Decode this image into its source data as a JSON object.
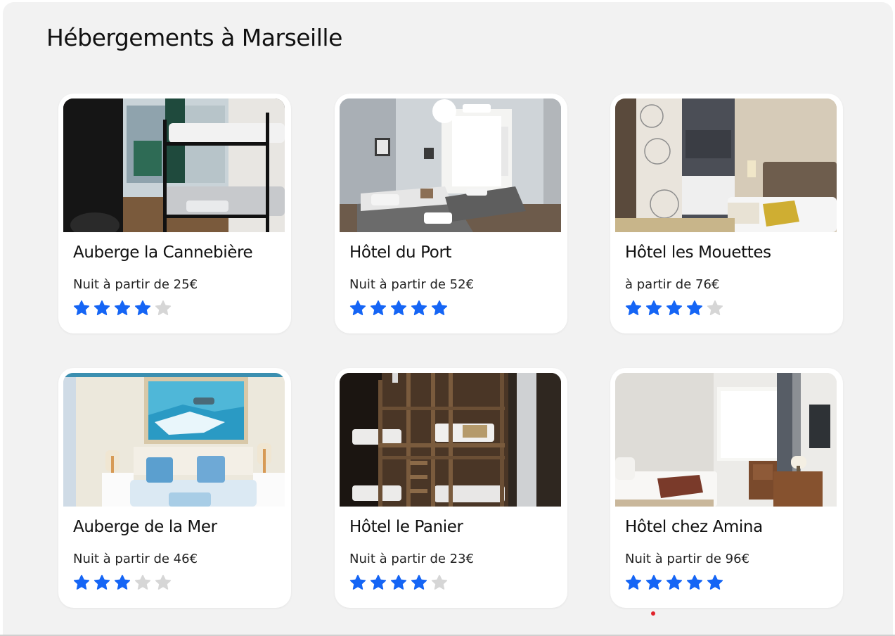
{
  "page": {
    "title": "Hébergements à Marseille"
  },
  "colors": {
    "star_filled": "#1565f5",
    "star_empty": "#d6d6d6",
    "background": "#f2f2f2",
    "card": "#ffffff",
    "indicator": "#e0232b"
  },
  "listings": [
    {
      "name": "Auberge la Cannebière",
      "price": "Nuit à partir de 25€",
      "rating": 4,
      "rating_max": 5,
      "image_icon": "dorm-bunk-bed-photo"
    },
    {
      "name": "Hôtel du Port",
      "price": "Nuit à partir de 52€",
      "rating": 5,
      "rating_max": 5,
      "image_icon": "twin-room-photo"
    },
    {
      "name": "Hôtel les Mouettes",
      "price": "à partir de 76€",
      "rating": 4,
      "rating_max": 5,
      "image_icon": "hotel-room-mirror-photo"
    },
    {
      "name": "Auberge de la Mer",
      "price": "Nuit à partir de 46€",
      "rating": 3,
      "rating_max": 5,
      "image_icon": "sea-painting-room-photo"
    },
    {
      "name": "Hôtel le Panier",
      "price": "Nuit à partir de 23€",
      "rating": 4,
      "rating_max": 5,
      "image_icon": "wooden-bunks-photo"
    },
    {
      "name": "Hôtel chez Amina",
      "price": "Nuit à partir de 96€",
      "rating": 5,
      "rating_max": 5,
      "image_icon": "bright-hotel-room-photo"
    }
  ]
}
